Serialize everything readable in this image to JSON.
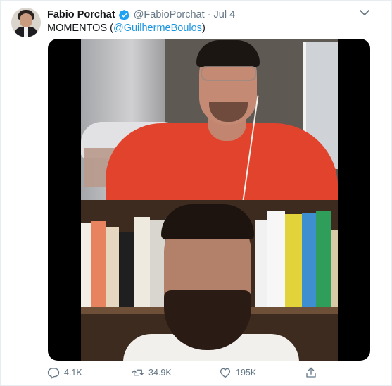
{
  "tweet": {
    "author_name": "Fabio Porchat",
    "handle": "@FabioPorchat",
    "separator": "·",
    "date": "Jul 4",
    "text_prefix": "MOMENTOS (",
    "mention": "@GuilhermeBoulos",
    "text_suffix": ")"
  },
  "actions": {
    "replies": "4.1K",
    "retweets": "34.9K",
    "likes": "195K"
  },
  "colors": {
    "accent": "#1b95e0",
    "muted": "#657786"
  },
  "icons": [
    "verified-badge-icon",
    "chevron-down-icon",
    "reply-icon",
    "retweet-icon",
    "like-icon",
    "share-icon"
  ]
}
